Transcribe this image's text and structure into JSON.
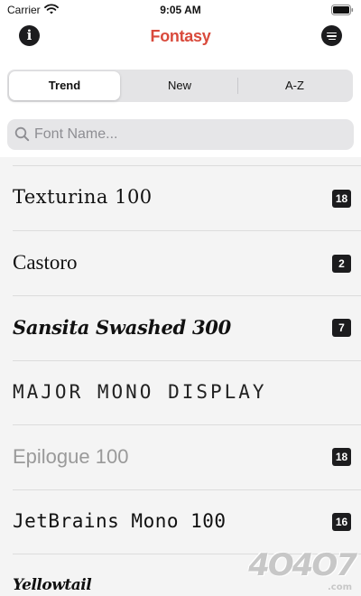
{
  "status_bar": {
    "carrier": "Carrier",
    "time": "9:05 AM",
    "wifi_icon": "wifi-icon",
    "battery_icon": "battery-icon"
  },
  "nav": {
    "title": "Fontasy",
    "title_color": "#d94a3c",
    "info_icon": "info-icon",
    "info_glyph": "i",
    "menu_icon": "menu-icon"
  },
  "segments": [
    {
      "label": "Trend",
      "selected": true
    },
    {
      "label": "New",
      "selected": false
    },
    {
      "label": "A-Z",
      "selected": false
    }
  ],
  "search": {
    "placeholder": "Font Name...",
    "value": ""
  },
  "fonts": [
    {
      "name": "Texturina 100",
      "count": "18"
    },
    {
      "name": "Castoro",
      "count": "2"
    },
    {
      "name": "Sansita Swashed 300",
      "count": "7"
    },
    {
      "name": "MAJOR MONO DISPLAY",
      "count": ""
    },
    {
      "name": "Epilogue 100",
      "count": "18"
    },
    {
      "name": "JetBrains Mono 100",
      "count": "16"
    },
    {
      "name": "Yellowtail",
      "count": ""
    }
  ],
  "watermark": {
    "text": "4O4O7",
    "suffix": ".com"
  }
}
